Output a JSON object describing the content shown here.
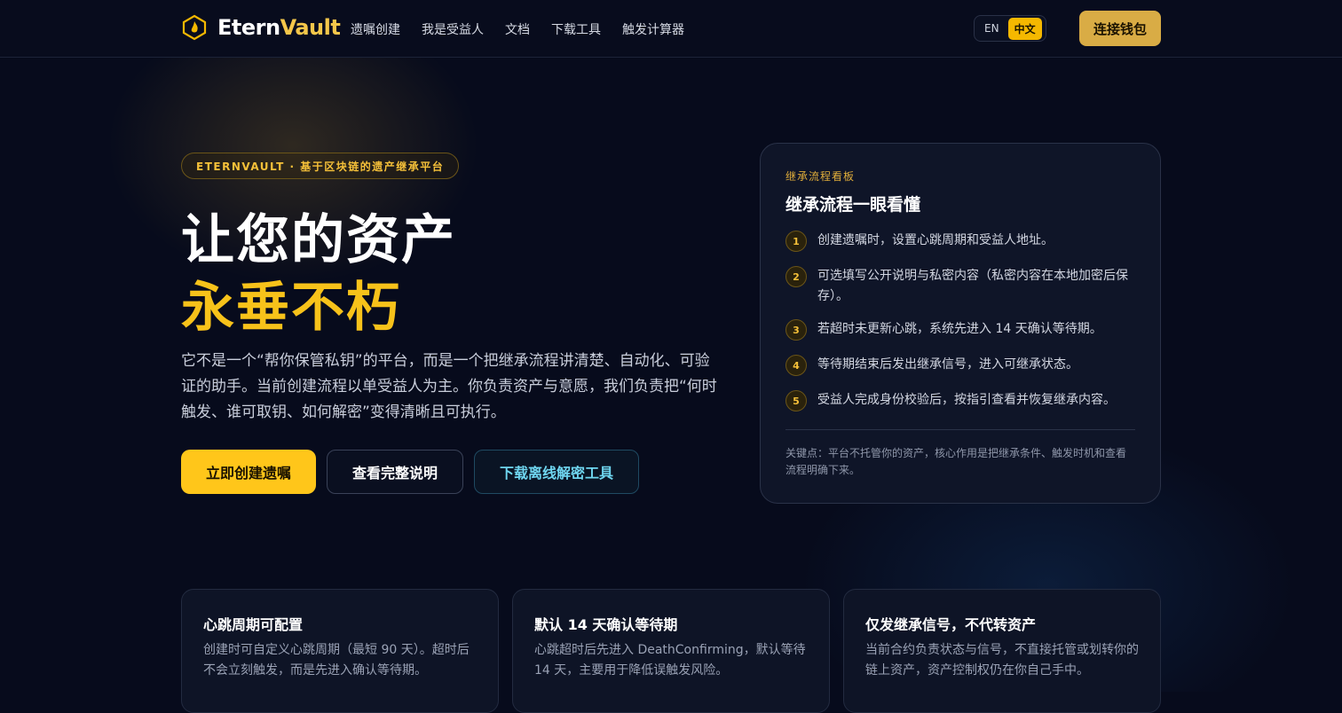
{
  "brand": {
    "name_part1": "Etern",
    "name_part2": "Vault"
  },
  "nav": {
    "items": [
      "遗嘱创建",
      "我是受益人",
      "文档",
      "下载工具",
      "触发计算器"
    ]
  },
  "lang": {
    "en": "EN",
    "zh": "中文",
    "active": "zh"
  },
  "wallet_button": "连接钱包",
  "hero": {
    "badge": "ETERNVAULT · 基于区块链的遗产继承平台",
    "title_line1": "让您的资产",
    "title_line2": "永垂不朽",
    "description": "它不是一个“帮你保管私钥”的平台，而是一个把继承流程讲清楚、自动化、可验证的助手。当前创建流程以单受益人为主。你负责资产与意愿，我们负责把“何时触发、谁可取钥、如何解密”变得清晰且可执行。",
    "buttons": {
      "primary": "立即创建遗嘱",
      "secondary": "查看完整说明",
      "tertiary": "下载离线解密工具"
    }
  },
  "process_card": {
    "kicker": "继承流程看板",
    "title": "继承流程一眼看懂",
    "steps": [
      {
        "num": "1",
        "text": "创建遗嘱时，设置心跳周期和受益人地址。"
      },
      {
        "num": "2",
        "text": "可选填写公开说明与私密内容（私密内容在本地加密后保存）。"
      },
      {
        "num": "3",
        "text": "若超时未更新心跳，系统先进入 14 天确认等待期。"
      },
      {
        "num": "4",
        "text": "等待期结束后发出继承信号，进入可继承状态。"
      },
      {
        "num": "5",
        "text": "受益人完成身份校验后，按指引查看并恢复继承内容。"
      }
    ],
    "key_note": "关键点：平台不托管你的资产，核心作用是把继承条件、触发时机和查看流程明确下来。"
  },
  "features": [
    {
      "title": "心跳周期可配置",
      "desc": "创建时可自定义心跳周期（最短 90 天）。超时后不会立刻触发，而是先进入确认等待期。"
    },
    {
      "title": "默认 14 天确认等待期",
      "desc": "心跳超时后先进入 DeathConfirming，默认等待 14 天，主要用于降低误触发风险。"
    },
    {
      "title": "仅发继承信号，不代转资产",
      "desc": "当前合约负责状态与信号，不直接托管或划转你的链上资产，资产控制权仍在你自己手中。"
    }
  ],
  "colors": {
    "accent": "#f5c039",
    "background": "#070b1c",
    "cyan": "#6fd6f0"
  }
}
